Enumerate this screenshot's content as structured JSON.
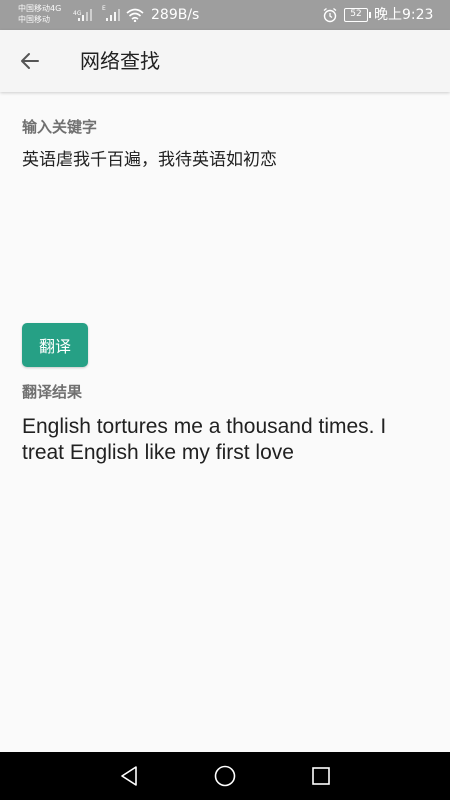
{
  "status_bar": {
    "carrier_line1": "中国移动4G",
    "carrier_line2": "中国移动",
    "net_type": "4G",
    "signal2_type": "E",
    "net_speed": "289B/s",
    "battery": "52",
    "time": "晚上9:23",
    "icons": [
      "signal-icon",
      "wifi-icon",
      "alarm-icon",
      "battery-icon"
    ]
  },
  "toolbar": {
    "back_icon": "arrow-left-icon",
    "title": "网络查找"
  },
  "input_section": {
    "label": "输入关键字",
    "value": "英语虐我千百遍，我待英语如初恋"
  },
  "translate_button": {
    "label": "翻译",
    "color": "#26a085"
  },
  "result_section": {
    "label": "翻译结果",
    "text": "English tortures me a thousand times. I treat English like my first love"
  },
  "nav_bar": {
    "icons": [
      "nav-back-icon",
      "nav-home-icon",
      "nav-recent-icon"
    ]
  }
}
